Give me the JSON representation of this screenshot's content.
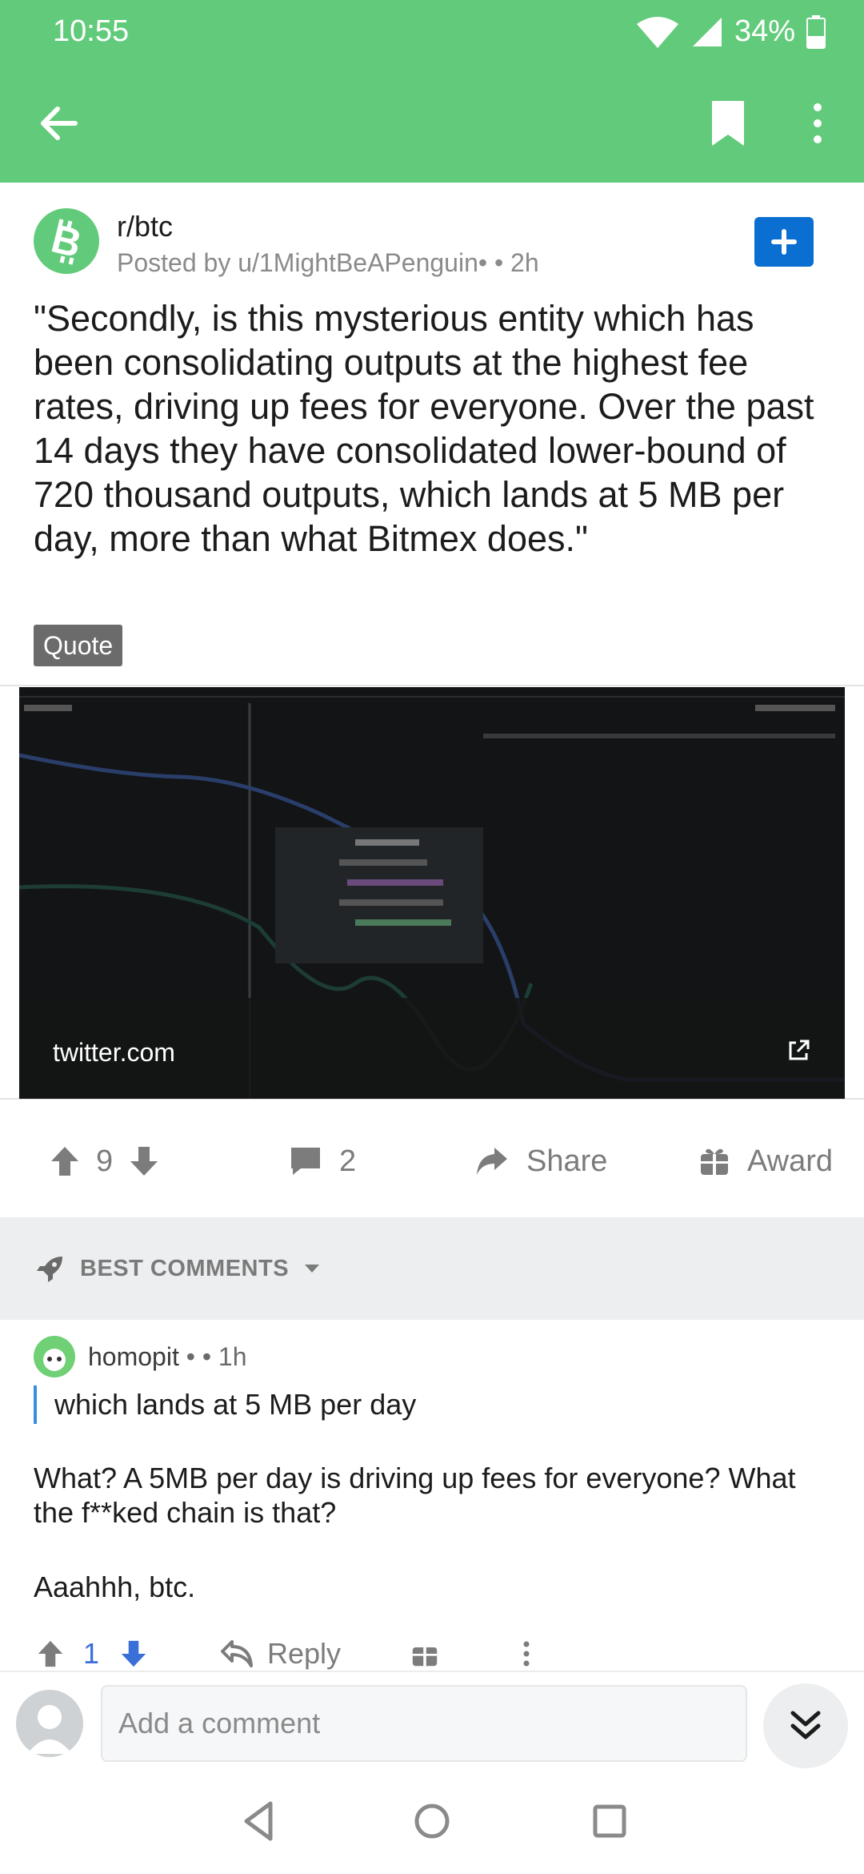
{
  "status_bar": {
    "time": "10:55",
    "battery": "34%"
  },
  "app_bar": {
    "back_icon": "arrow-left-icon",
    "bookmark_icon": "bookmark-icon",
    "more_icon": "more-vertical-icon"
  },
  "post": {
    "subreddit": "r/btc",
    "posted_by": "Posted by u/1MightBeAPenguin•  • 2h",
    "title": "\"Secondly, is this mysterious entity which has been consolidating outputs at the highest fee rates, driving up fees for everyone. Over the past 14 days they have consolidated lower-bound of 720 thousand outputs, which lands at 5 MB per day, more than what Bitmex does.\"",
    "flair": "Quote",
    "link_domain": "twitter.com",
    "votes": "9",
    "comments": "2",
    "share_label": "Share",
    "award_label": "Award"
  },
  "comments_header": {
    "sort_label": "BEST COMMENTS"
  },
  "comment": {
    "user": "homopit",
    "meta": " •  • 1h",
    "quote": "which lands at 5 MB per day",
    "body": [
      "What? A 5MB per day is driving up fees for everyone? What the f**ked chain is that?",
      "Aaahhh, btc."
    ],
    "votes": "1",
    "reply_label": "Reply"
  },
  "composer": {
    "placeholder": "Add a comment"
  },
  "colors": {
    "header_green": "#62cb7b",
    "join_blue": "#0a6fd0",
    "upvote_blue": "#3a6fd8"
  }
}
